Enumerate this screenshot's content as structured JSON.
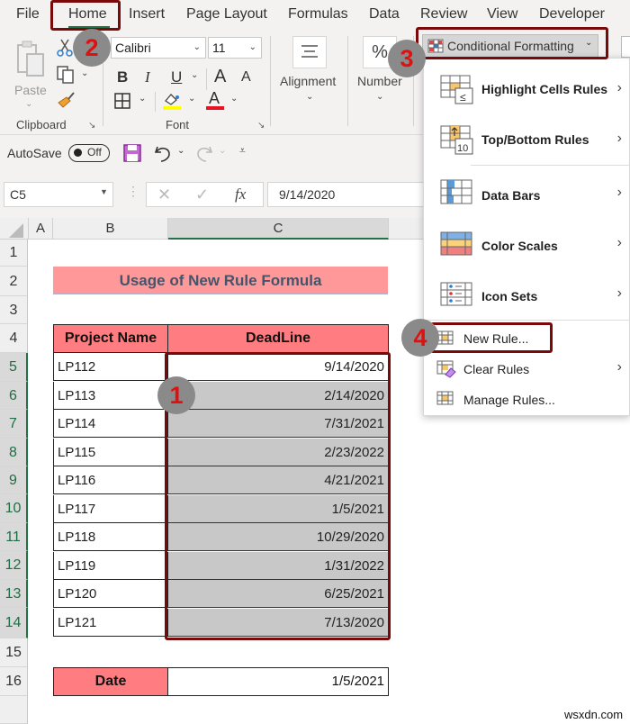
{
  "ribbon_tabs": [
    "File",
    "Home",
    "Insert",
    "Page Layout",
    "Formulas",
    "Data",
    "Review",
    "View",
    "Developer"
  ],
  "active_tab": "Home",
  "clipboard": {
    "paste_label": "Paste",
    "group_label": "Clipboard"
  },
  "font": {
    "name": "Calibri",
    "size": "11",
    "group_label": "Font",
    "bold": "B",
    "italic": "I",
    "underline": "U",
    "grow": "A",
    "shrink": "A",
    "fill_color": "#ffff00",
    "font_color": "#e81123"
  },
  "alignment": {
    "label": "Alignment"
  },
  "number": {
    "label": "Number",
    "icon": "%"
  },
  "conditional_formatting": {
    "label": "Conditional Formatting"
  },
  "menu": {
    "items": [
      {
        "label": "Highlight Cells Rules",
        "has_submenu": true
      },
      {
        "label": "Top/Bottom Rules",
        "has_submenu": true
      },
      {
        "label": "Data Bars",
        "has_submenu": true
      },
      {
        "label": "Color Scales",
        "has_submenu": true
      },
      {
        "label": "Icon Sets",
        "has_submenu": true
      },
      {
        "label": "New Rule...",
        "has_submenu": false
      },
      {
        "label": "Clear Rules",
        "has_submenu": true
      },
      {
        "label": "Manage Rules...",
        "has_submenu": false
      }
    ]
  },
  "qat": {
    "autosave_label": "AutoSave",
    "autosave_state": "Off"
  },
  "formula_bar": {
    "name_box": "C5",
    "value": "9/14/2020",
    "fx": "fx"
  },
  "columns": [
    "A",
    "B",
    "C"
  ],
  "rows": [
    "1",
    "2",
    "3",
    "4",
    "5",
    "6",
    "7",
    "8",
    "9",
    "10",
    "11",
    "12",
    "13",
    "14",
    "15",
    "16"
  ],
  "sheet": {
    "title": "Usage of New Rule Formula",
    "headers": [
      "Project Name",
      "DeadLine"
    ],
    "data": [
      [
        "LP112",
        "9/14/2020"
      ],
      [
        "LP113",
        "2/14/2020"
      ],
      [
        "LP114",
        "7/31/2021"
      ],
      [
        "LP115",
        "2/23/2022"
      ],
      [
        "LP116",
        "4/21/2021"
      ],
      [
        "LP117",
        "1/5/2021"
      ],
      [
        "LP118",
        "10/29/2020"
      ],
      [
        "LP119",
        "1/31/2022"
      ],
      [
        "LP120",
        "6/25/2021"
      ],
      [
        "LP121",
        "7/13/2020"
      ]
    ],
    "date_label": "Date",
    "date_value": "1/5/2021"
  },
  "steps": [
    "1",
    "2",
    "3",
    "4"
  ],
  "watermark": "wsxdn.com",
  "colors": {
    "header_fill": "#ff7c80",
    "title_fill": "#ff9999",
    "title_text": "#44546a",
    "selection_fill": "#c8c8c8",
    "highlight_border": "#7a0a0a",
    "excel_green": "#217346"
  }
}
